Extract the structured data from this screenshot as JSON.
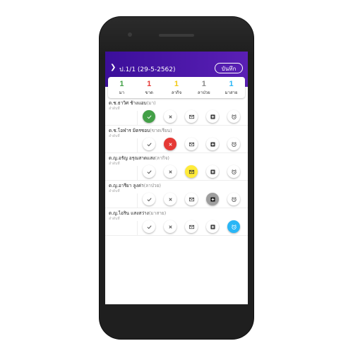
{
  "header": {
    "title": "ป.1/1 (29-5-2562)",
    "save_label": "บันทึก"
  },
  "summary": [
    {
      "count": "1",
      "label": "มา",
      "color": "#43a047"
    },
    {
      "count": "1",
      "label": "ขาด",
      "color": "#e53935"
    },
    {
      "count": "1",
      "label": "ลากิจ",
      "color": "#f2c811"
    },
    {
      "count": "1",
      "label": "ลาป่วย",
      "color": "#8a8a8a"
    },
    {
      "count": "1",
      "label": "มาสาย",
      "color": "#29b6f6"
    }
  ],
  "students": [
    {
      "name": "ด.ช.ธาวิศ ช้างแอบ",
      "status": "(มา)",
      "sub": "ลำดับที่",
      "active": 0
    },
    {
      "name": "ด.ช.โอฬาร มิตรชอบ",
      "status": "(ขาดเรียน)",
      "sub": "ลำดับที่",
      "active": 1
    },
    {
      "name": "ด.ญ.อรัญ อรุณสาดแสง",
      "status": "(ลากิจ)",
      "sub": "ลำดับที่",
      "active": 2
    },
    {
      "name": "ด.ญ.อารียา ลูงค่า",
      "status": "(ลาป่วย)",
      "sub": "ลำดับที่",
      "active": 3
    },
    {
      "name": "ด.ญ.ไอริน แสงสว่าง",
      "status": "(มาสาย)",
      "sub": "ลำดับที่",
      "active": 4
    }
  ],
  "buttons": [
    {
      "name": "present-button",
      "icon": "check-icon",
      "active_class": "active-green"
    },
    {
      "name": "absent-button",
      "icon": "close-icon",
      "active_class": "active-red"
    },
    {
      "name": "leave-button",
      "icon": "mail-icon",
      "active_class": "active-yellow"
    },
    {
      "name": "sick-leave-button",
      "icon": "medical-plus-icon",
      "active_class": "active-gray"
    },
    {
      "name": "late-button",
      "icon": "alarm-clock-icon",
      "active_class": "active-blue"
    }
  ]
}
